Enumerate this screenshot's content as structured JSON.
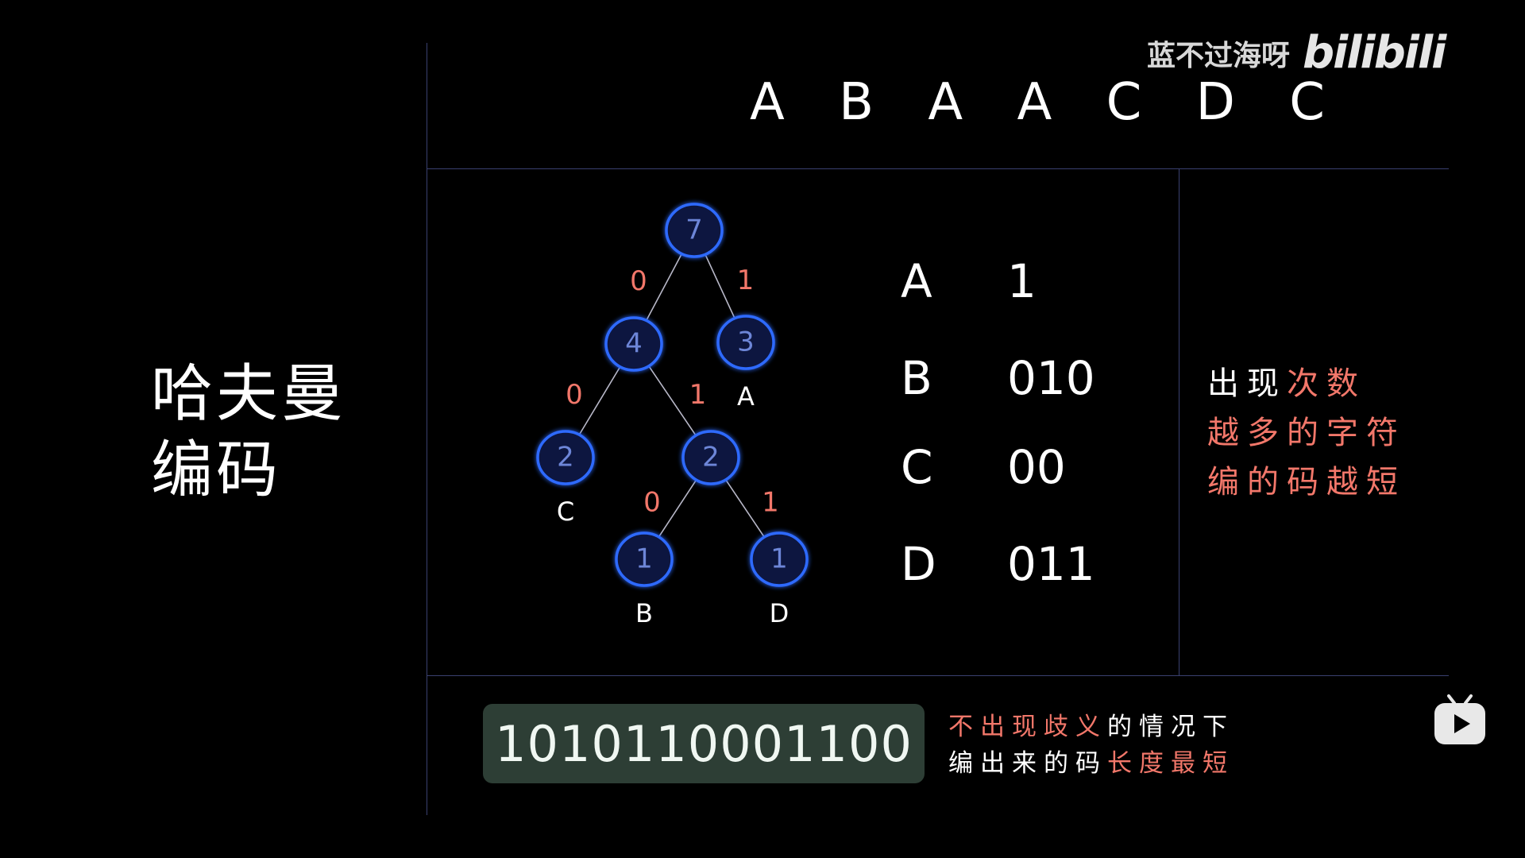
{
  "title": {
    "line1": "哈夫曼",
    "line2": "编码"
  },
  "sequence": "A B A A C D C",
  "watermark": {
    "name": "蓝不过海呀",
    "logo": "bilibili"
  },
  "tree": {
    "nodes": [
      {
        "id": "root",
        "value": "7"
      },
      {
        "id": "n4",
        "value": "4"
      },
      {
        "id": "n3",
        "value": "3",
        "label": "A"
      },
      {
        "id": "n2c",
        "value": "2",
        "label": "C"
      },
      {
        "id": "n2",
        "value": "2"
      },
      {
        "id": "n1b",
        "value": "1",
        "label": "B"
      },
      {
        "id": "n1d",
        "value": "1",
        "label": "D"
      }
    ],
    "edges": [
      {
        "from": "root",
        "to": "n4",
        "bit": "0"
      },
      {
        "from": "root",
        "to": "n3",
        "bit": "1"
      },
      {
        "from": "n4",
        "to": "n2c",
        "bit": "0"
      },
      {
        "from": "n4",
        "to": "n2",
        "bit": "1"
      },
      {
        "from": "n2",
        "to": "n1b",
        "bit": "0"
      },
      {
        "from": "n2",
        "to": "n1d",
        "bit": "1"
      }
    ]
  },
  "codes": [
    {
      "char": "A",
      "code": "1"
    },
    {
      "char": "B",
      "code": "010"
    },
    {
      "char": "C",
      "code": "00"
    },
    {
      "char": "D",
      "code": "011"
    }
  ],
  "note_frequency": {
    "line1_plain": "出现",
    "line1_red": "次数",
    "line2": "越多的字符",
    "line3": "编的码越短"
  },
  "encoded": "1010110001100",
  "note_length": {
    "line1_red": "不出现歧义",
    "line1_plain": "的情况下",
    "line2_plain": "编出来的码",
    "line2_red": "长度最短"
  },
  "colors": {
    "background": "#000000",
    "node_fill": "#0d1640",
    "node_stroke": "#2d6bff",
    "node_text": "#6d86d8",
    "edge_bit": "#f2776a",
    "divider": "#3a4070",
    "accent_red": "#f2776a",
    "code_box": "#2d3e35"
  },
  "icons": {
    "play": "bilibili-tv-play-icon"
  }
}
